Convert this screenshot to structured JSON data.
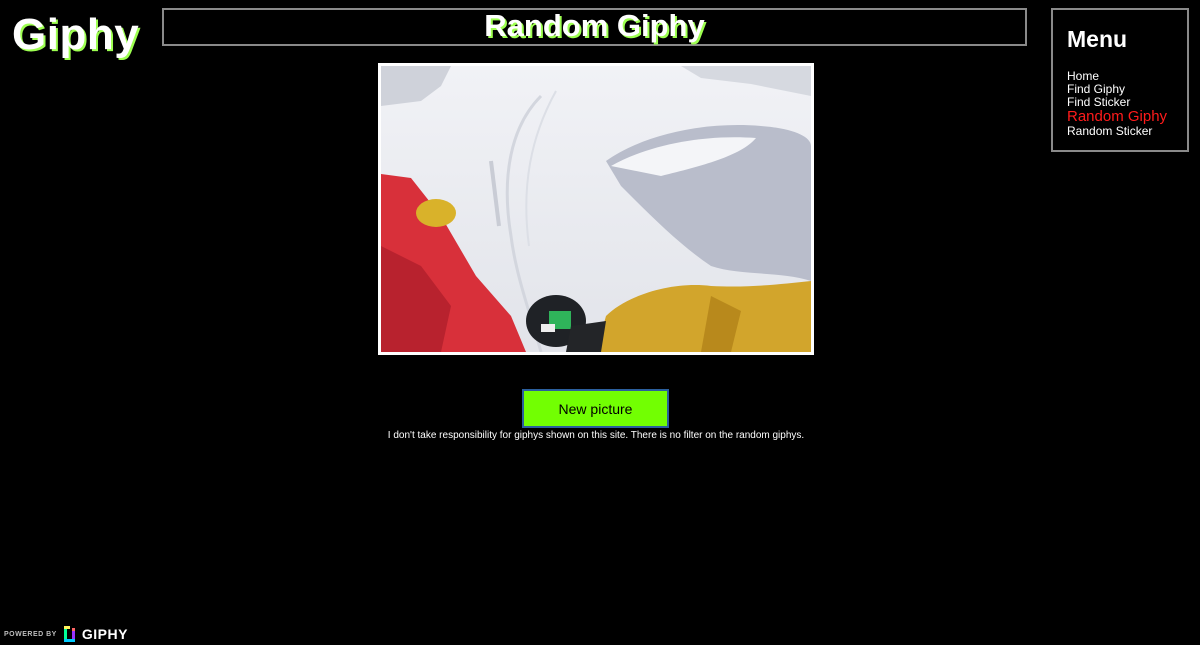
{
  "logo": {
    "text": "Giphy"
  },
  "header": {
    "title": "Random Giphy"
  },
  "menu": {
    "heading": "Menu",
    "items": [
      {
        "label": "Home",
        "active": false
      },
      {
        "label": "Find Giphy",
        "active": false
      },
      {
        "label": "Find Sticker",
        "active": false
      },
      {
        "label": "Random Giphy",
        "active": true
      },
      {
        "label": "Random Sticker",
        "active": false
      }
    ]
  },
  "main": {
    "gif_icon": "snowboard-gif-image",
    "button_label": "New picture",
    "disclaimer": "I don't take responsibility for giphys shown on this site. There is no filter on the random giphys."
  },
  "footer": {
    "powered_by": "POWERED BY",
    "brand": "GIPHY",
    "brand_icon": "giphy-logo-icon"
  },
  "colors": {
    "background": "#000000",
    "title_shadow": "#9dff50",
    "button": "#72ff02",
    "button_border": "#2b5f9e",
    "active_menu": "#ff1b1b",
    "frame_border": "#8a8a8a"
  }
}
